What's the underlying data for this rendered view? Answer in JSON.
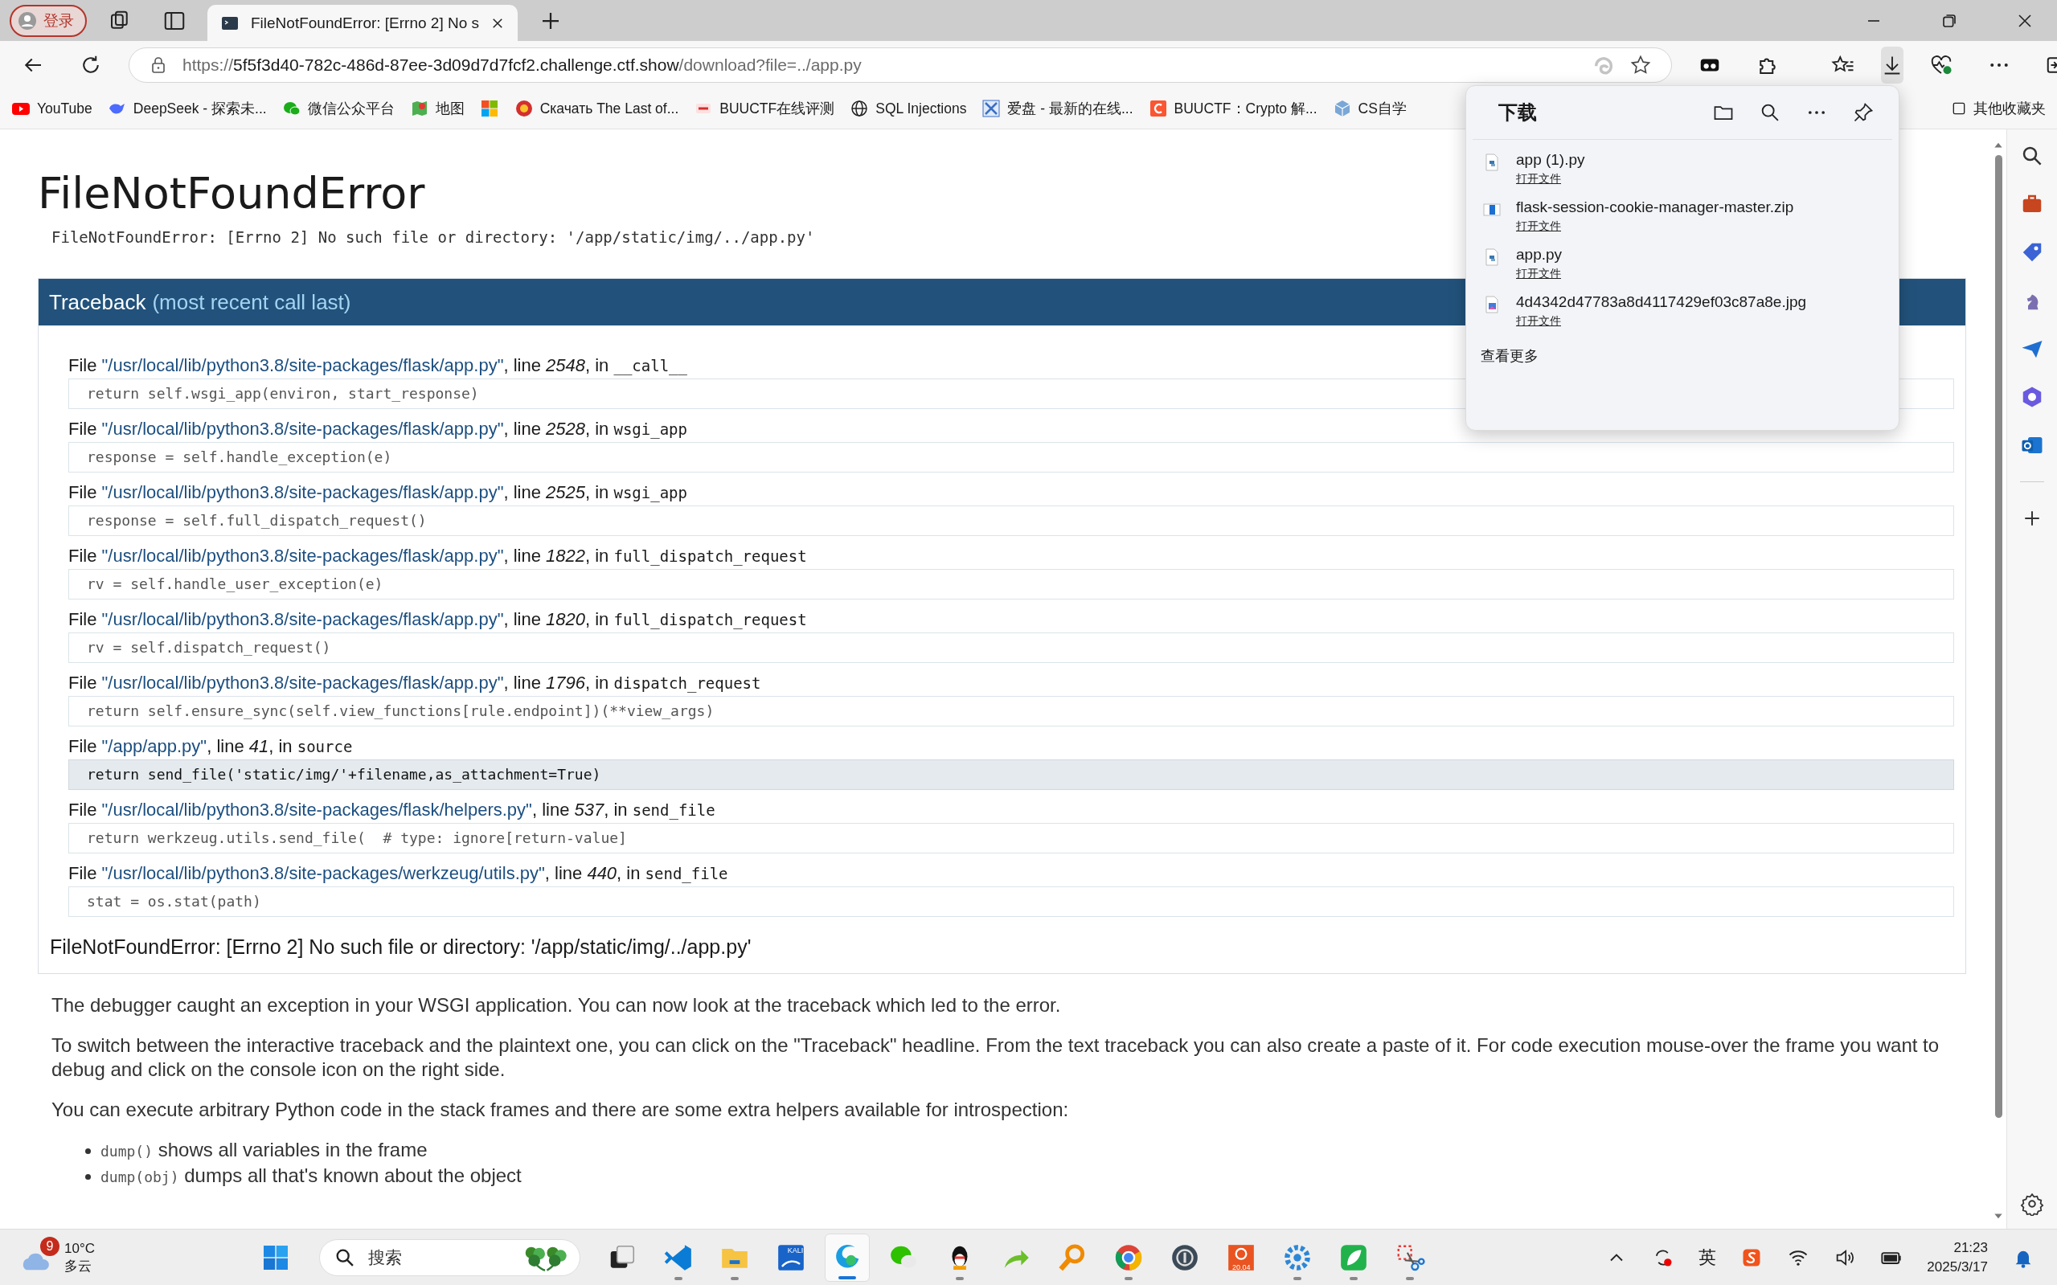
{
  "browser": {
    "profile": {
      "label": "登录"
    },
    "tabs": [
      {
        "title": "FileNotFoundError: [Errno 2] No s",
        "selected": true
      }
    ],
    "address": {
      "scheme": "https://",
      "host": "5f5f3d40-782c-486d-87ee-3d09d7d7fcf2.challenge.ctf.show",
      "path": "/download?file=../app.py"
    },
    "bookmarks": [
      {
        "kind": "youtube",
        "label": "YouTube"
      },
      {
        "kind": "whale",
        "label": "DeepSeek - 探索未..."
      },
      {
        "kind": "chat",
        "label": "微信公众平台"
      },
      {
        "kind": "map",
        "label": "地图"
      },
      {
        "kind": "windows"
      },
      {
        "kind": "emblem",
        "label": "Скачать The Last of..."
      },
      {
        "kind": "pas",
        "label": "BUUCTF在线评测"
      },
      {
        "kind": "globe",
        "label": "SQL Injections"
      },
      {
        "kind": "cross",
        "label": "爱盘 - 最新的在线..."
      },
      {
        "kind": "c-square",
        "label": "BUUCTF：Crypto 解..."
      },
      {
        "kind": "cube",
        "label": "CS自学"
      }
    ],
    "other_bookmarks": "其他收藏夹"
  },
  "page": {
    "title": "FileNotFoundError",
    "message": "FileNotFoundError: [Errno 2] No such file or directory: '/app/static/img/../app.py'",
    "traceback": {
      "label": "Traceback",
      "note": "(most recent call last)",
      "frames": [
        {
          "file_prefix": "File",
          "path": "\"/usr/local/lib/python3.8/site-packages/flask/app.py\"",
          "line_prefix": ", line",
          "line": "2548",
          "in_prefix": ", in",
          "function": "__call__",
          "code": "return self.wsgi_app(environ, start_response)",
          "library": true
        },
        {
          "file_prefix": "File",
          "path": "\"/usr/local/lib/python3.8/site-packages/flask/app.py\"",
          "line_prefix": ", line",
          "line": "2528",
          "in_prefix": ", in",
          "function": "wsgi_app",
          "code": "response = self.handle_exception(e)",
          "library": true
        },
        {
          "file_prefix": "File",
          "path": "\"/usr/local/lib/python3.8/site-packages/flask/app.py\"",
          "line_prefix": ", line",
          "line": "2525",
          "in_prefix": ", in",
          "function": "wsgi_app",
          "code": "response = self.full_dispatch_request()",
          "library": true
        },
        {
          "file_prefix": "File",
          "path": "\"/usr/local/lib/python3.8/site-packages/flask/app.py\"",
          "line_prefix": ", line",
          "line": "1822",
          "in_prefix": ", in",
          "function": "full_dispatch_request",
          "code": "rv = self.handle_user_exception(e)",
          "library": true
        },
        {
          "file_prefix": "File",
          "path": "\"/usr/local/lib/python3.8/site-packages/flask/app.py\"",
          "line_prefix": ", line",
          "line": "1820",
          "in_prefix": ", in",
          "function": "full_dispatch_request",
          "code": "rv = self.dispatch_request()",
          "library": true
        },
        {
          "file_prefix": "File",
          "path": "\"/usr/local/lib/python3.8/site-packages/flask/app.py\"",
          "line_prefix": ", line",
          "line": "1796",
          "in_prefix": ", in",
          "function": "dispatch_request",
          "code": "return self.ensure_sync(self.view_functions[rule.endpoint])(**view_args)",
          "library": true
        },
        {
          "file_prefix": "File",
          "path": "\"/app/app.py\"",
          "line_prefix": ", line",
          "line": "41",
          "in_prefix": ", in",
          "function": "source",
          "code": "return send_file('static/img/'+filename,as_attachment=True)",
          "library": false
        },
        {
          "file_prefix": "File",
          "path": "\"/usr/local/lib/python3.8/site-packages/flask/helpers.py\"",
          "line_prefix": ", line",
          "line": "537",
          "in_prefix": ", in",
          "function": "send_file",
          "code": "return werkzeug.utils.send_file(  # type: ignore[return-value]",
          "library": true
        },
        {
          "file_prefix": "File",
          "path": "\"/usr/local/lib/python3.8/site-packages/werkzeug/utils.py\"",
          "line_prefix": ", line",
          "line": "440",
          "in_prefix": ", in",
          "function": "send_file",
          "code": "stat = os.stat(path)",
          "library": true
        }
      ],
      "error": "FileNotFoundError: [Errno 2] No such file or directory: '/app/static/img/../app.py'"
    },
    "paragraphs": [
      "The debugger caught an exception in your WSGI application. You can now look at the traceback which led to the error.",
      "To switch between the interactive traceback and the plaintext one, you can click on the \"Traceback\" headline. From the text traceback you can also create a paste of it. For code execution mouse-over the frame you want to debug and click on the console icon on the right side.",
      "You can execute arbitrary Python code in the stack frames and there are some extra helpers available for introspection:"
    ],
    "helpers": [
      {
        "code": "dump()",
        "text": "shows all variables in the frame"
      },
      {
        "code": "dump(obj)",
        "text": "dumps all that's known about the object"
      }
    ]
  },
  "downloads": {
    "title": "下载",
    "items": [
      {
        "kind": "python",
        "name": "app (1).py",
        "action": "打开文件"
      },
      {
        "kind": "archive",
        "name": "flask-session-cookie-manager-master.zip",
        "action": "打开文件"
      },
      {
        "kind": "python",
        "name": "app.py",
        "action": "打开文件"
      },
      {
        "kind": "image",
        "name": "4d4342d47783a8d4117429ef03c87a8e.jpg",
        "action": "打开文件"
      }
    ],
    "more": "查看更多"
  },
  "taskbar": {
    "weather": {
      "badge": "9",
      "temperature": "10°C",
      "condition": "多云"
    },
    "search": {
      "placeholder": "搜索"
    },
    "apps": [
      {
        "kind": "windows-stack",
        "running": false,
        "active": false
      },
      {
        "kind": "code",
        "running": true,
        "active": false
      },
      {
        "kind": "folder",
        "running": true,
        "active": false
      },
      {
        "kind": "kali",
        "label": "KALI",
        "running": false,
        "active": false
      },
      {
        "kind": "edge",
        "running": true,
        "active": true
      },
      {
        "kind": "chat",
        "running": false,
        "active": false
      },
      {
        "kind": "penguin",
        "running": true,
        "active": false
      },
      {
        "kind": "arrow",
        "running": false,
        "active": false
      },
      {
        "kind": "magnifier",
        "running": false,
        "active": false
      },
      {
        "kind": "chrome",
        "running": true,
        "active": false
      },
      {
        "kind": "compass",
        "running": false,
        "active": false
      },
      {
        "kind": "ubuntu",
        "label": "20.04",
        "running": false,
        "active": false
      },
      {
        "kind": "gear",
        "running": true,
        "active": false
      },
      {
        "kind": "leaf",
        "running": true,
        "active": false
      },
      {
        "kind": "scissors",
        "running": true,
        "active": false
      }
    ],
    "ime": "英",
    "time": "21:23",
    "date": "2025/3/17"
  }
}
